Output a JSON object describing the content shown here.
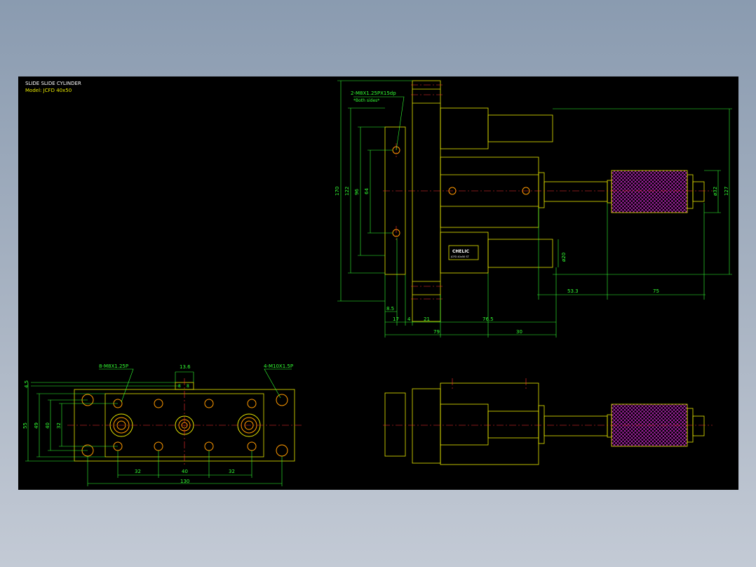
{
  "title": "SLIDE SLIDE CYLINDER",
  "model": "Model: JCFD 40x50",
  "brand_label": "CHELIC",
  "brand_sub": "JCFD 40x50 ST",
  "colors": {
    "background": "#000000",
    "outline": "#e8e800",
    "dimension": "#33ff33",
    "centerline": "#ff3030",
    "hole": "#ff9900",
    "hatch": "#ff33ff"
  },
  "side_view": {
    "callout_holes": "2-M8X1.25PX15dp",
    "callout_note": "*Both sides*",
    "dims": {
      "d170": "170",
      "d122": "122",
      "d96": "96",
      "d64": "64",
      "d32": "ø32",
      "d127": "127",
      "d20": "ø20",
      "d53": "53.3",
      "d75": "75",
      "d8_5": "8.5",
      "d17": "17",
      "d4": "4",
      "d21": "21",
      "d76_5": "76.5",
      "d79": "79",
      "d30": "30"
    }
  },
  "plan_view": {
    "callout_left": "8-M8X1.25P",
    "callout_right": "4-M10X1.5P",
    "dims": {
      "d13_6": "13.6",
      "d8a": "8",
      "d8b": "8",
      "d4_5": "4.5",
      "d55": "55",
      "d49": "49",
      "d40v": "40",
      "d32v": "32",
      "d32a": "32",
      "d40h": "40",
      "d32b": "32",
      "d130": "130"
    }
  }
}
